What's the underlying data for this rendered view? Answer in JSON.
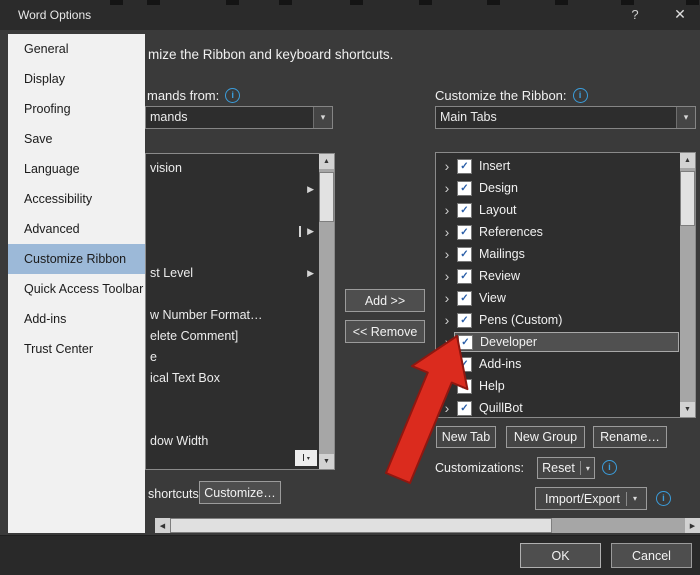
{
  "colors": {
    "selection_blue": "#9cb9d8",
    "info_blue": "#3b9ddb",
    "check_blue": "#2b5fa8",
    "annotation_red": "#db2b1e"
  },
  "icons": {
    "info": "i",
    "dropdown": "▾",
    "flyout": "▶",
    "check": "✓",
    "chevron": "›",
    "scroll_up": "▲",
    "scroll_down": "▼",
    "scroll_left": "◀",
    "scroll_right": "▶",
    "cursor": "I",
    "help": "?",
    "close": "✕"
  },
  "titlebar": {
    "title": "Word Options"
  },
  "sidebar": {
    "items": [
      {
        "label": "General",
        "selected": false
      },
      {
        "label": "Display",
        "selected": false
      },
      {
        "label": "Proofing",
        "selected": false
      },
      {
        "label": "Save",
        "selected": false
      },
      {
        "label": "Language",
        "selected": false
      },
      {
        "label": "Accessibility",
        "selected": false
      },
      {
        "label": "Advanced",
        "selected": false
      },
      {
        "label": "Customize Ribbon",
        "selected": true
      },
      {
        "label": "Quick Access Toolbar",
        "selected": false
      },
      {
        "label": "Add-ins",
        "selected": false
      },
      {
        "label": "Trust Center",
        "selected": false
      }
    ]
  },
  "main": {
    "heading": "mize the Ribbon and keyboard shortcuts.",
    "left_panel": {
      "label": "mands from:",
      "dropdown_value": "mands",
      "list_rows": [
        {
          "text": "vision",
          "arrow": false,
          "bar": false
        },
        {
          "text": "",
          "arrow": true,
          "bar": false
        },
        {
          "text": "",
          "arrow": false,
          "bar": false
        },
        {
          "text": "",
          "arrow": true,
          "bar": true
        },
        {
          "text": "",
          "arrow": false,
          "bar": false
        },
        {
          "text": "st Level",
          "arrow": true,
          "bar": false
        },
        {
          "text": "",
          "arrow": false,
          "bar": false
        },
        {
          "text": "w Number Format…",
          "arrow": false,
          "bar": false
        },
        {
          "text": "elete Comment]",
          "arrow": false,
          "bar": false
        },
        {
          "text": "e",
          "arrow": false,
          "bar": false
        },
        {
          "text": "ical Text Box",
          "arrow": false,
          "bar": false
        },
        {
          "text": "",
          "arrow": false,
          "bar": false
        },
        {
          "text": "",
          "arrow": false,
          "bar": false
        },
        {
          "text": "dow Width",
          "arrow": false,
          "bar": false
        }
      ],
      "shortcuts_label": "shortcuts:",
      "customize_button": "Customize…"
    },
    "transfer": {
      "add_button": "Add >>",
      "remove_button": "<< Remove"
    },
    "right_panel": {
      "label": "Customize the Ribbon:",
      "dropdown_value": "Main Tabs",
      "tabs": [
        {
          "label": "Insert",
          "checked": true,
          "highlighted": false
        },
        {
          "label": "Design",
          "checked": true,
          "highlighted": false
        },
        {
          "label": "Layout",
          "checked": true,
          "highlighted": false
        },
        {
          "label": "References",
          "checked": true,
          "highlighted": false
        },
        {
          "label": "Mailings",
          "checked": true,
          "highlighted": false
        },
        {
          "label": "Review",
          "checked": true,
          "highlighted": false
        },
        {
          "label": "View",
          "checked": true,
          "highlighted": false
        },
        {
          "label": "Pens (Custom)",
          "checked": true,
          "highlighted": false
        },
        {
          "label": "Developer",
          "checked": true,
          "highlighted": true
        },
        {
          "label": "Add-ins",
          "checked": true,
          "highlighted": false
        },
        {
          "label": "Help",
          "checked": true,
          "highlighted": false
        },
        {
          "label": "QuillBot",
          "checked": true,
          "highlighted": false
        }
      ],
      "new_tab_button": "New Tab",
      "new_group_button": "New Group",
      "rename_button": "Rename…",
      "customizations_label": "Customizations:",
      "reset_button": "Reset",
      "import_export_button": "Import/Export"
    },
    "footer": {
      "ok_button": "OK",
      "cancel_button": "Cancel"
    }
  }
}
